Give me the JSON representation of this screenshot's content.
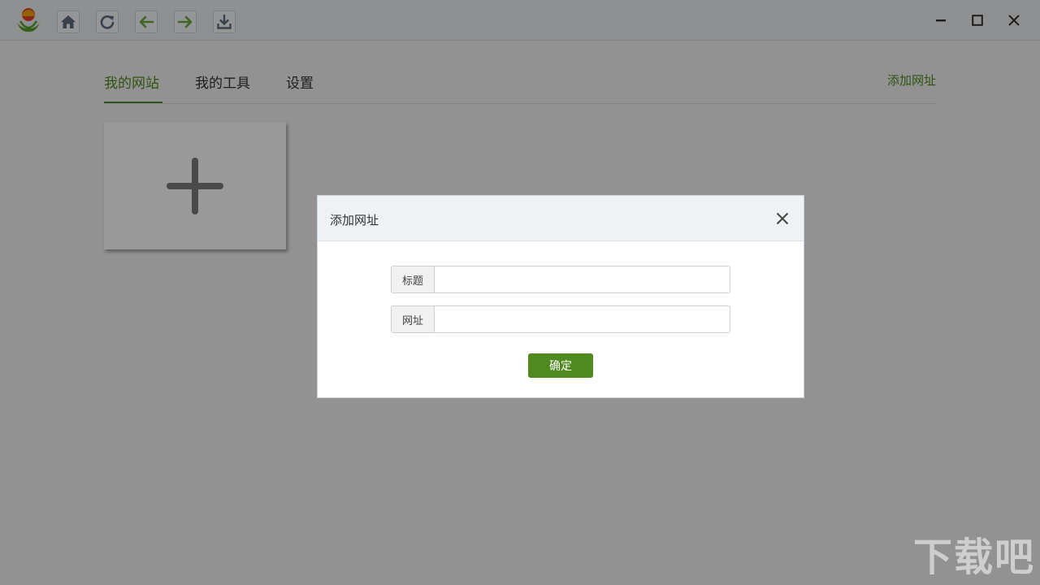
{
  "toolbar": {
    "logo": "app-logo",
    "buttons": [
      "home-icon",
      "refresh-icon",
      "back-icon",
      "forward-icon",
      "download-icon"
    ]
  },
  "window_controls": {
    "minimize": "minimize-icon",
    "maximize": "maximize-icon",
    "close": "close-icon"
  },
  "nav": {
    "tabs": [
      {
        "label": "我的网站",
        "active": true
      },
      {
        "label": "我的工具",
        "active": false
      },
      {
        "label": "设置",
        "active": false
      }
    ],
    "add_link": "添加网址"
  },
  "dialog": {
    "title": "添加网址",
    "fields": [
      {
        "label": "标题",
        "value": "",
        "placeholder": ""
      },
      {
        "label": "网址",
        "value": "",
        "placeholder": ""
      }
    ],
    "confirm_label": "确定"
  },
  "colors": {
    "accent": "#4f8a1f",
    "titlebar": "#edf0f3",
    "overlay": "rgba(0,0,0,0.4)"
  },
  "watermark": "下载吧"
}
